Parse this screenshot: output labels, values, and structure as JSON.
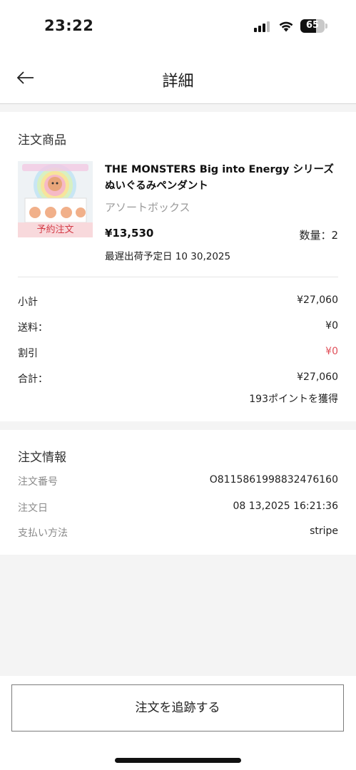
{
  "status_bar": {
    "time": "23:22",
    "battery": "65",
    "battery_level": 0.65
  },
  "nav": {
    "title": "詳細"
  },
  "products_section": {
    "title": "注文商品",
    "product": {
      "name": "THE MONSTERS Big into Energy シリーズぬいぐるみペンダント",
      "variant": "アソートボックス",
      "badge": "予約注文",
      "price": "¥13,530",
      "quantity": "数量：2",
      "ship_date": "最遅出荷予定日 10 30,2025"
    }
  },
  "summary": {
    "subtotal_label": "小計",
    "subtotal_value": "¥27,060",
    "shipping_label": "送料：",
    "shipping_value": "¥0",
    "discount_label": "割引",
    "discount_value": "¥0",
    "total_label": "合計：",
    "total_value": "¥27,060",
    "points": "193ポイントを獲得"
  },
  "order_info": {
    "title": "注文情報",
    "number_label": "注文番号",
    "number_value": "O8115861998832476160",
    "date_label": "注文日",
    "date_value": "08 13,2025 16:21:36",
    "payment_label": "支払い方法",
    "payment_value": "stripe"
  },
  "actions": {
    "track_label": "注文を追跡する"
  },
  "colors": {
    "accent_red": "#e0505a",
    "badge_bg": "#f8d9dc"
  }
}
